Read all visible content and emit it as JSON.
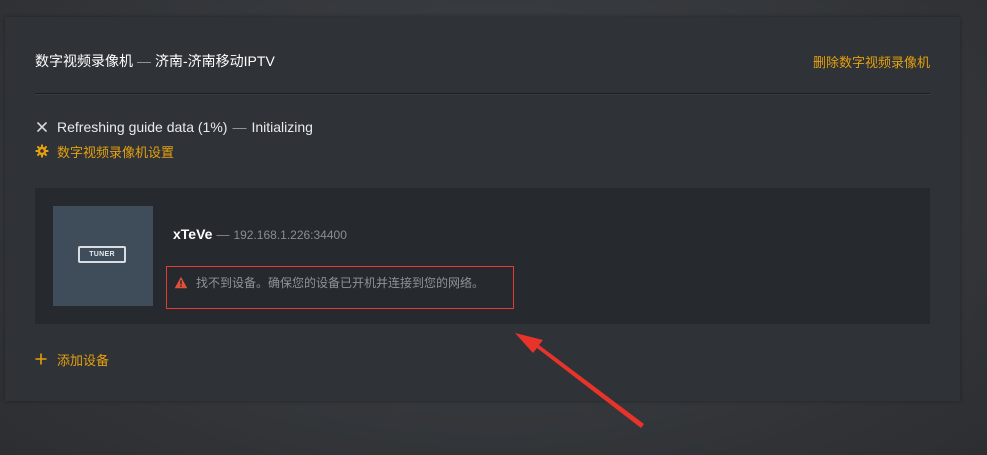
{
  "header": {
    "dvr_label": "数字视频录像机",
    "separator": "—",
    "dvr_source": "济南-济南移动IPTV",
    "delete_label": "删除数字视频录像机"
  },
  "status": {
    "icon": "close-icon",
    "text": "Refreshing guide data (1%)",
    "separator": "—",
    "state": "Initializing"
  },
  "settings": {
    "icon": "gear-icon",
    "label": "数字视频录像机设置"
  },
  "device": {
    "badge": "TUNER",
    "name": "xTeVe",
    "separator": "—",
    "address": "192.168.1.226:34400",
    "error_icon": "warning-icon",
    "error_message": "找不到设备。确保您的设备已开机并连接到您的网络。"
  },
  "add_device": {
    "icon": "plus-icon",
    "label": "添加设备"
  },
  "colors": {
    "accent": "#e5a00d",
    "error_outline": "#e23b32",
    "warning": "#e0503a",
    "annotation_arrow": "#e8332b",
    "panel": "#2f3338",
    "card": "#26292d",
    "thumbnail": "#3f4d5a"
  }
}
